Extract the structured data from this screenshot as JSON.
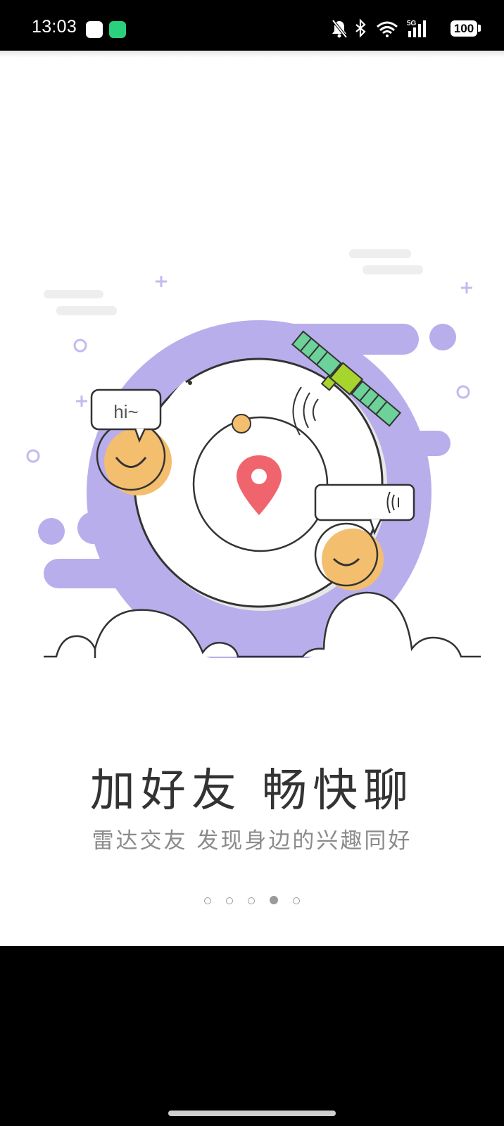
{
  "status_bar": {
    "time": "13:03",
    "battery_level": "100",
    "icons": [
      "mute-bell-icon",
      "bluetooth-icon",
      "wifi-icon",
      "5g-signal-icon",
      "battery-icon"
    ]
  },
  "illustration": {
    "bubble_hi_text": "hi~"
  },
  "onboarding": {
    "title": "加好友 畅快聊",
    "subtitle": "雷达交友 发现身边的兴趣同好",
    "page_indicator": {
      "total": 5,
      "active_index": 4
    }
  },
  "colors": {
    "accent_purple": "#B9AEEC",
    "pin_red": "#F0646E",
    "smiley_orange": "#F3BE6E",
    "satellite_green": "#6DD19A",
    "satellite_lime": "#A8D42E"
  }
}
